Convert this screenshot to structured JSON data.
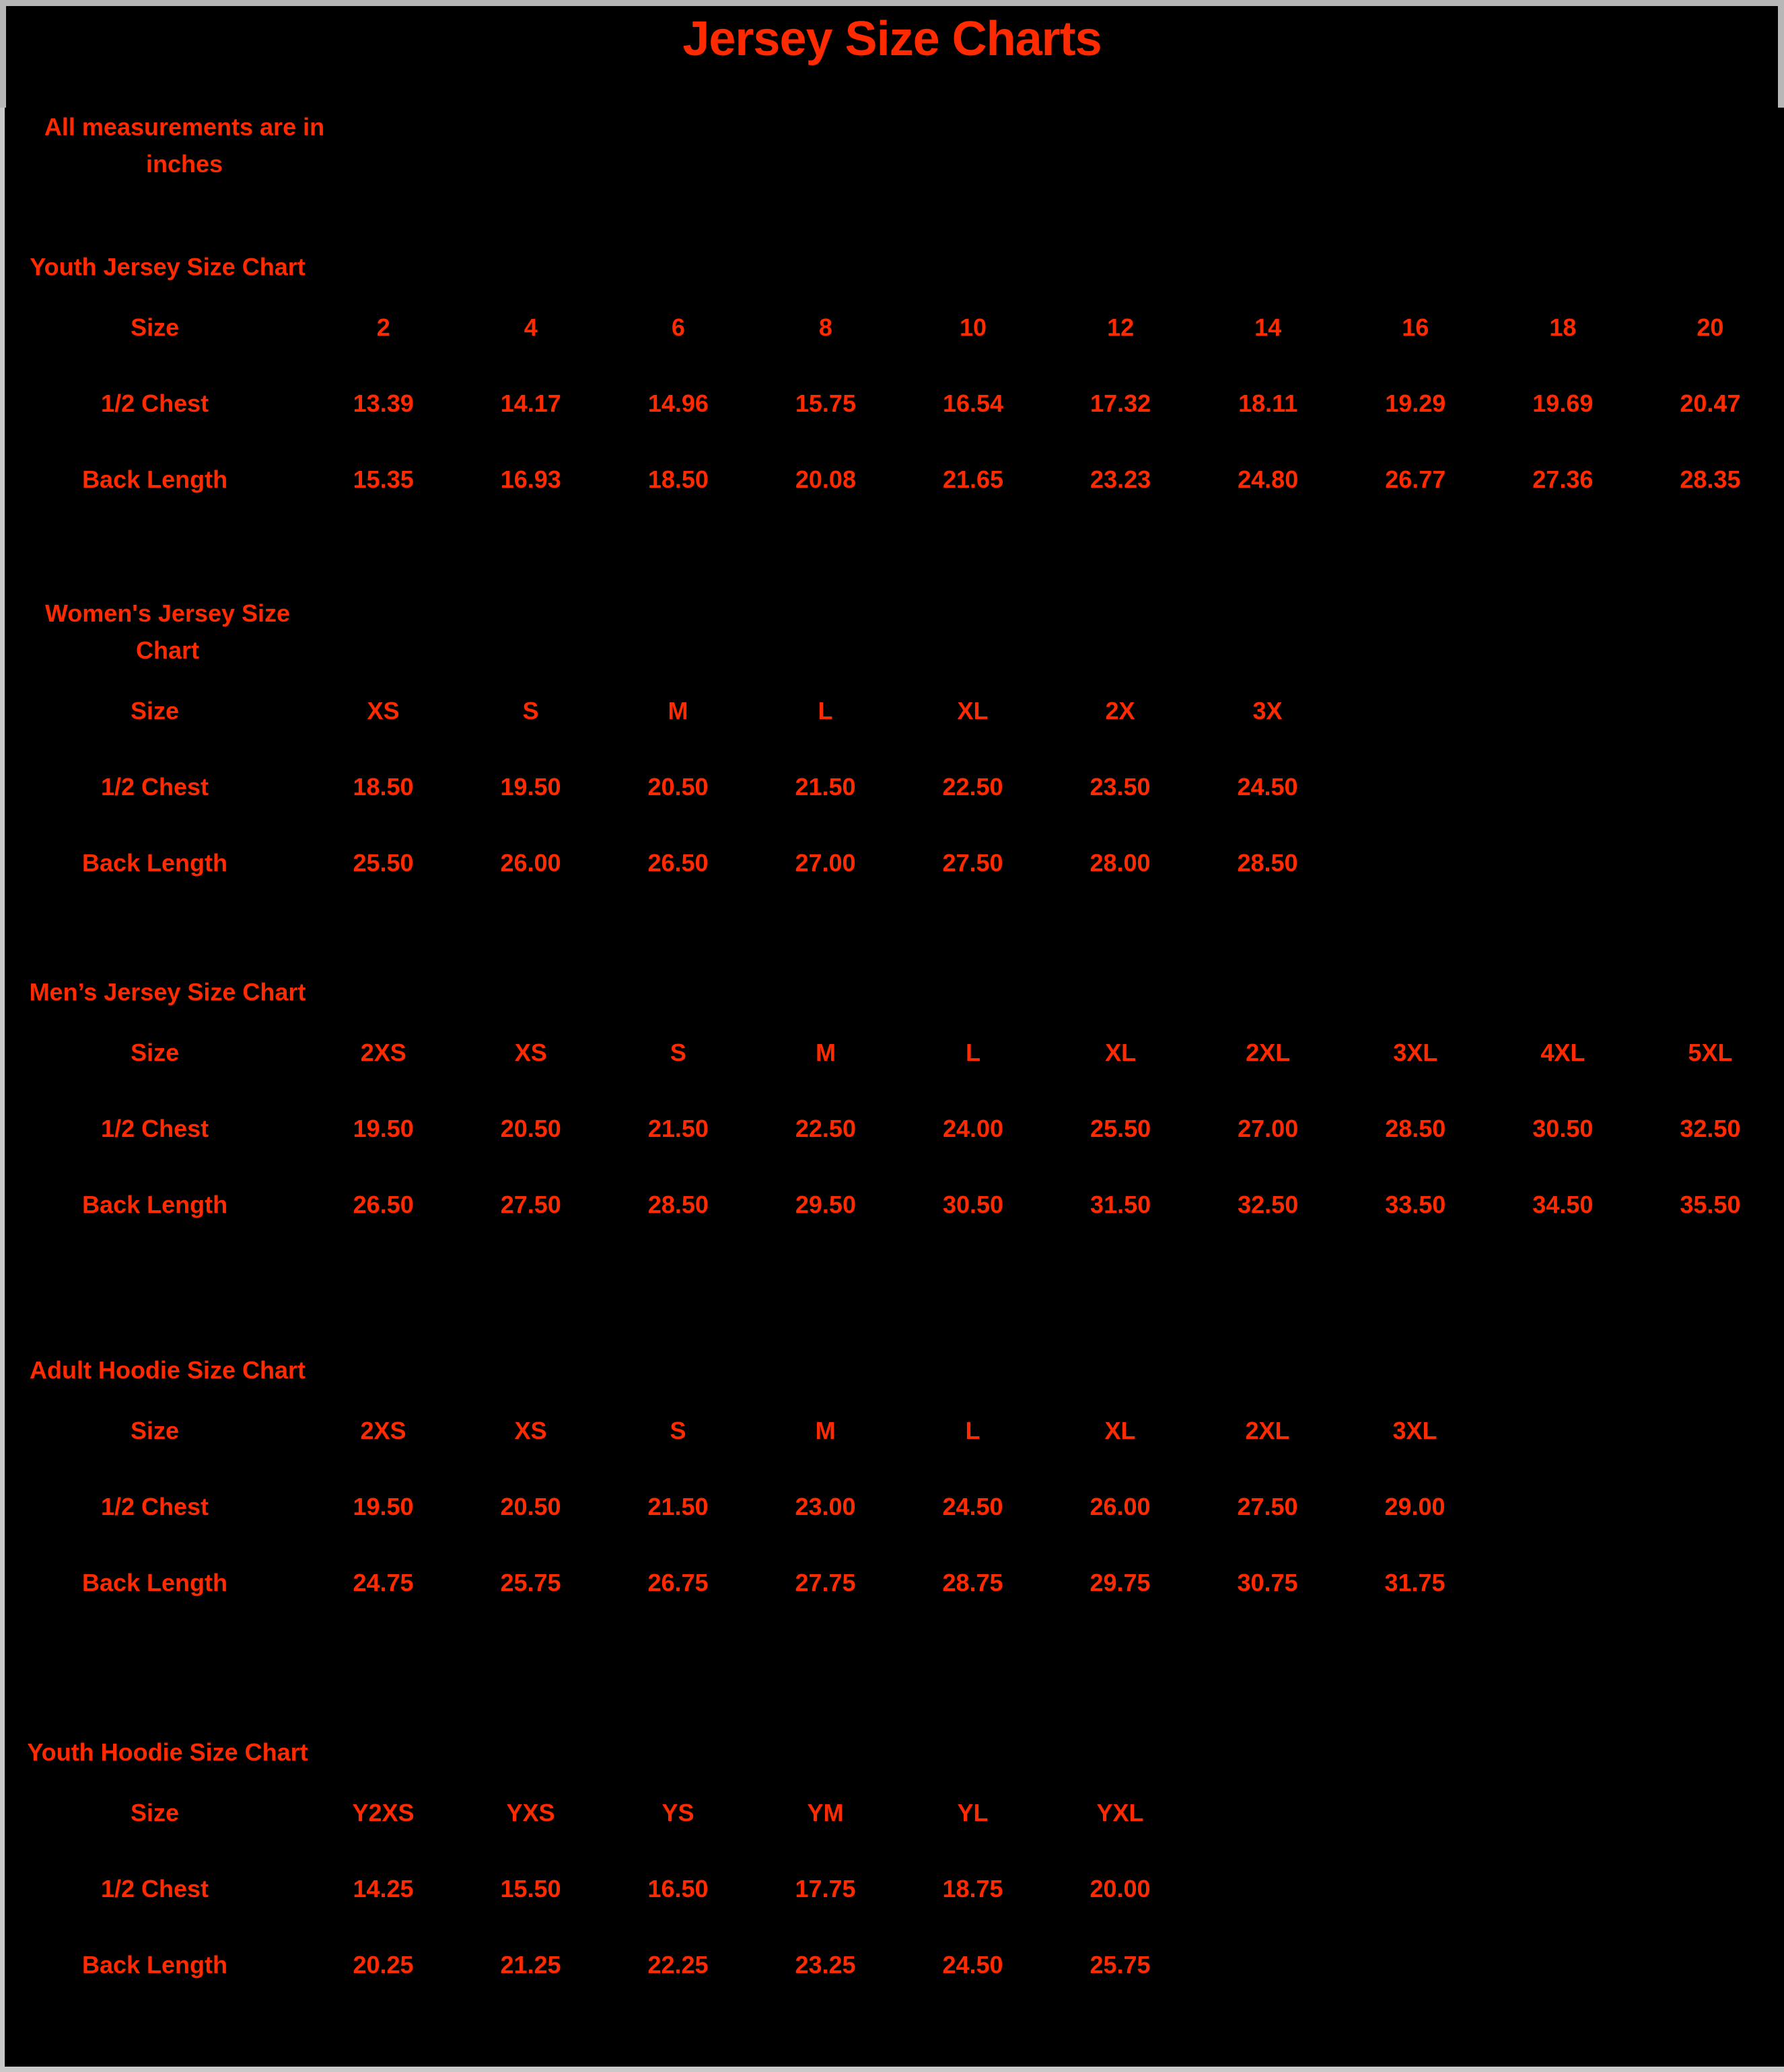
{
  "document": {
    "title": "Jersey Size Charts",
    "note": "All measurements are in inches",
    "accent_color": "#ff2a00",
    "background_color": "#000000",
    "frame_color": "#c9c9c9"
  },
  "sections": [
    {
      "title": "Youth Jersey Size Chart",
      "size_label": "Size",
      "chest_label": "1/2 Chest",
      "length_label": "Back Length",
      "sizes": [
        "2",
        "4",
        "6",
        "8",
        "10",
        "12",
        "14",
        "16",
        "18",
        "20"
      ],
      "half_chest": [
        "13.39",
        "14.17",
        "14.96",
        "15.75",
        "16.54",
        "17.32",
        "18.11",
        "19.29",
        "19.69",
        "20.47"
      ],
      "back_length": [
        "15.35",
        "16.93",
        "18.50",
        "20.08",
        "21.65",
        "23.23",
        "24.80",
        "26.77",
        "27.36",
        "28.35"
      ]
    },
    {
      "title": "Women's Jersey Size Chart",
      "size_label": "Size",
      "chest_label": "1/2 Chest",
      "length_label": "Back Length",
      "sizes": [
        "XS",
        "S",
        "M",
        "L",
        "XL",
        "2X",
        "3X"
      ],
      "half_chest": [
        "18.50",
        "19.50",
        "20.50",
        "21.50",
        "22.50",
        "23.50",
        "24.50"
      ],
      "back_length": [
        "25.50",
        "26.00",
        "26.50",
        "27.00",
        "27.50",
        "28.00",
        "28.50"
      ]
    },
    {
      "title": "Men’s Jersey Size Chart",
      "size_label": "Size",
      "chest_label": "1/2 Chest",
      "length_label": "Back Length",
      "sizes": [
        "2XS",
        "XS",
        "S",
        "M",
        "L",
        "XL",
        "2XL",
        "3XL",
        "4XL",
        "5XL"
      ],
      "half_chest": [
        "19.50",
        "20.50",
        "21.50",
        "22.50",
        "24.00",
        "25.50",
        "27.00",
        "28.50",
        "30.50",
        "32.50"
      ],
      "back_length": [
        "26.50",
        "27.50",
        "28.50",
        "29.50",
        "30.50",
        "31.50",
        "32.50",
        "33.50",
        "34.50",
        "35.50"
      ]
    },
    {
      "title": "Adult Hoodie Size Chart",
      "size_label": "Size",
      "chest_label": "1/2 Chest",
      "length_label": "Back Length",
      "sizes": [
        "2XS",
        "XS",
        "S",
        "M",
        "L",
        "XL",
        "2XL",
        "3XL"
      ],
      "half_chest": [
        "19.50",
        "20.50",
        "21.50",
        "23.00",
        "24.50",
        "26.00",
        "27.50",
        "29.00"
      ],
      "back_length": [
        "24.75",
        "25.75",
        "26.75",
        "27.75",
        "28.75",
        "29.75",
        "30.75",
        "31.75"
      ]
    },
    {
      "title": "Youth Hoodie Size Chart",
      "size_label": "Size",
      "chest_label": "1/2 Chest",
      "length_label": "Back Length",
      "sizes": [
        "Y2XS",
        "YXS",
        "YS",
        "YM",
        "YL",
        "YXL"
      ],
      "half_chest": [
        "14.25",
        "15.50",
        "16.50",
        "17.75",
        "18.75",
        "20.00"
      ],
      "back_length": [
        "20.25",
        "21.25",
        "22.25",
        "23.25",
        "24.50",
        "25.75"
      ]
    }
  ]
}
